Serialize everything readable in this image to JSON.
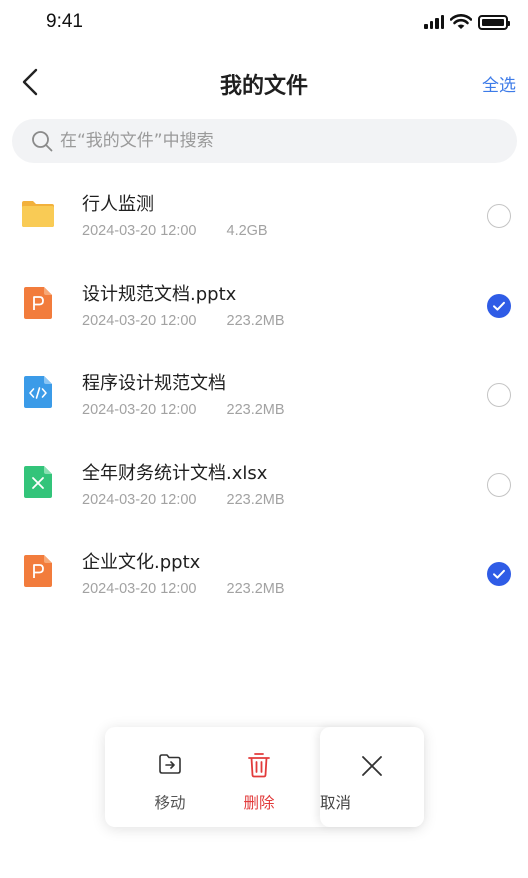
{
  "status_bar": {
    "time": "9:41"
  },
  "nav": {
    "title": "我的文件",
    "select_all": "全选"
  },
  "search": {
    "placeholder": "在“我的文件”中搜索"
  },
  "files": [
    {
      "name": "行人监测",
      "date": "2024-03-20 12:00",
      "size": "4.2GB",
      "type": "folder",
      "icon": "folder-icon",
      "selected": false
    },
    {
      "name": "设计规范文档.pptx",
      "date": "2024-03-20 12:00",
      "size": "223.2MB",
      "type": "pptx",
      "icon": "ppt-file-icon",
      "selected": true
    },
    {
      "name": "程序设计规范文档",
      "date": "2024-03-20 12:00",
      "size": "223.2MB",
      "type": "code",
      "icon": "code-file-icon",
      "selected": false
    },
    {
      "name": "全年财务统计文档.xlsx",
      "date": "2024-03-20 12:00",
      "size": "223.2MB",
      "type": "xlsx",
      "icon": "excel-file-icon",
      "selected": false
    },
    {
      "name": "企业文化.pptx",
      "date": "2024-03-20 12:00",
      "size": "223.2MB",
      "type": "pptx",
      "icon": "ppt-file-icon",
      "selected": true
    }
  ],
  "actions": {
    "move": "移动",
    "delete": "删除",
    "cancel": "取消"
  },
  "colors": {
    "accent": "#2f5ce6",
    "link": "#3d7be8",
    "danger": "#e23b3b",
    "folder": "#f7c64f",
    "ppt": "#f27c3c",
    "code": "#3b9be8",
    "excel": "#33c47a"
  }
}
